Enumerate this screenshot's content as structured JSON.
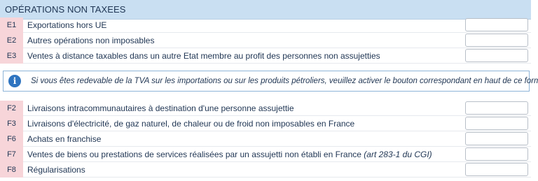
{
  "section": {
    "title": "OPÉRATIONS NON TAXEES"
  },
  "rows_top": [
    {
      "code": "E1",
      "label": "Exportations hors UE",
      "ref": "",
      "value": ""
    },
    {
      "code": "E2",
      "label": "Autres opérations non imposables",
      "ref": "",
      "value": ""
    },
    {
      "code": "E3",
      "label": "Ventes à distance taxables dans un autre Etat membre au profit des personnes non assujetties",
      "ref": "",
      "value": ""
    }
  ],
  "notice": {
    "icon": "info-icon",
    "text": "Si vous êtes redevable de la TVA sur les importations ou sur les produits pétroliers, veuillez activer le bouton correspondant en haut de ce formulaire"
  },
  "rows_bottom": [
    {
      "code": "F2",
      "label": "Livraisons intracommunautaires à destination d'une personne assujettie",
      "ref": "",
      "value": ""
    },
    {
      "code": "F3",
      "label": "Livraisons d'électricité, de gaz naturel, de chaleur ou de froid non imposables en France",
      "ref": "",
      "value": ""
    },
    {
      "code": "F6",
      "label": "Achats en franchise",
      "ref": "",
      "value": ""
    },
    {
      "code": "F7",
      "label": "Ventes de biens ou prestations de services réalisées par un assujetti non établi en France",
      "ref": "(art 283-1 du CGI)",
      "value": ""
    },
    {
      "code": "F8",
      "label": "Régularisations",
      "ref": "",
      "value": ""
    }
  ],
  "colors": {
    "header_bg": "#c9dff2",
    "code_bg": "#f7d5d9",
    "info_icon": "#2f74c0",
    "text": "#1f3553"
  }
}
